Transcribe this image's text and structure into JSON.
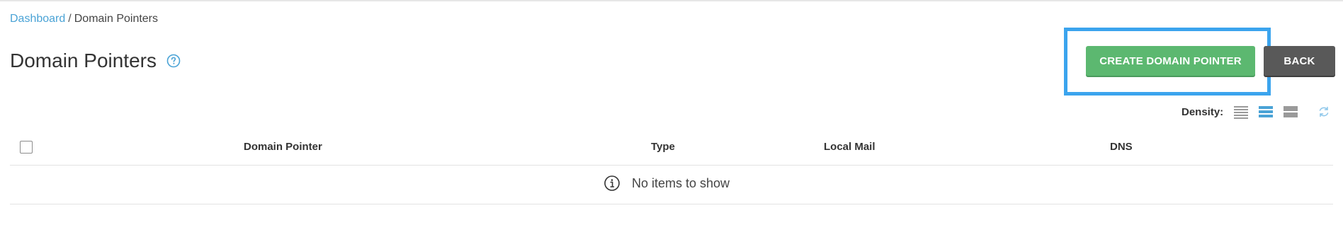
{
  "breadcrumb": {
    "home": "Dashboard",
    "separator": "/",
    "current": "Domain Pointers"
  },
  "page": {
    "title": "Domain Pointers"
  },
  "actions": {
    "create_label": "CREATE DOMAIN POINTER",
    "back_label": "BACK"
  },
  "density": {
    "label": "Density:",
    "options": [
      "compact",
      "normal",
      "comfortable"
    ],
    "selected": "normal"
  },
  "table": {
    "columns": [
      "Domain Pointer",
      "Type",
      "Local Mail",
      "DNS"
    ],
    "empty_message": "No items to show"
  },
  "colors": {
    "accent": "#4aa3d6",
    "create": "#5cb870",
    "back": "#595959",
    "highlight": "#3ba4ee"
  },
  "icons": {
    "help": "question-circle-icon",
    "refresh": "refresh-icon",
    "info": "info-circle-icon"
  }
}
